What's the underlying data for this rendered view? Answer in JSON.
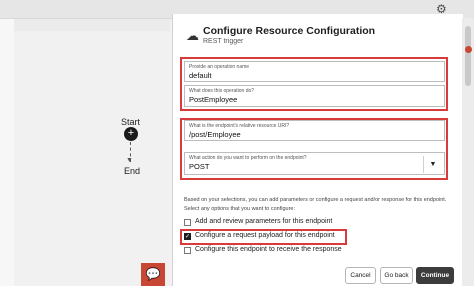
{
  "canvas": {
    "start_label": "Start",
    "end_label": "End"
  },
  "panel": {
    "title": "Configure Resource Configuration",
    "subtitle": "REST trigger",
    "operation_name": {
      "label": "Provide an operation name",
      "value": "default"
    },
    "operation_description": {
      "label": "What does this operation do?",
      "value": "PostEmployee"
    },
    "resource_uri": {
      "label": "What is the endpoint's relative resource URI?",
      "value": "/post/Employee"
    },
    "action": {
      "label": "What action do you want to perform on the endpoint?",
      "value": "POST"
    },
    "info_line1": "Based on your selections, you can add parameters or configure a request and/or response for this endpoint.",
    "info_line2": "Select any options that you want to configure:",
    "options": [
      {
        "label": "Add and review parameters for this endpoint",
        "checked": false
      },
      {
        "label": "Configure a request payload for this endpoint",
        "checked": true
      },
      {
        "label": "Configure this endpoint to receive the response",
        "checked": false
      }
    ],
    "buttons": {
      "cancel": "Cancel",
      "back": "Go back",
      "continue": "Continue"
    }
  },
  "colors": {
    "highlight": "#d93a3a",
    "accent": "#c74634",
    "primary_button": "#3c3c3c"
  },
  "icons": {
    "settings": "gear-icon",
    "panel": "cloud-gear-icon",
    "chat": "chat-icon",
    "dropdown": "caret-down-icon"
  }
}
